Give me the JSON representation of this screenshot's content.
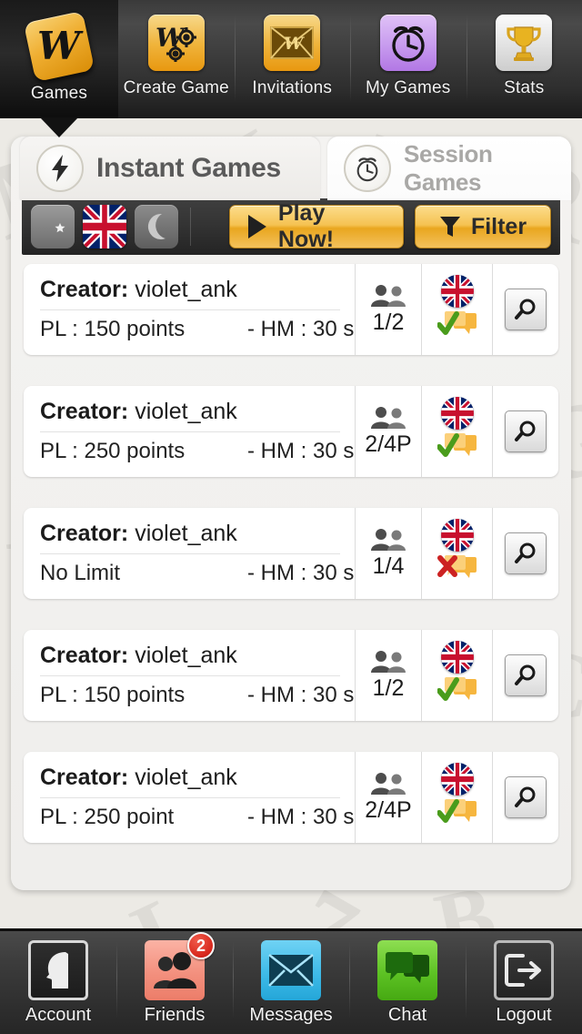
{
  "topnav": {
    "items": [
      {
        "label": "Games",
        "icon": "w-tile-icon",
        "active": true
      },
      {
        "label": "Create Game",
        "icon": "w-gears-icon",
        "active": false
      },
      {
        "label": "Invitations",
        "icon": "envelope-w-icon",
        "active": false
      },
      {
        "label": "My Games",
        "icon": "alarm-clock-icon",
        "active": false
      },
      {
        "label": "Stats",
        "icon": "trophy-icon",
        "active": false
      }
    ]
  },
  "tabs": [
    {
      "label": "Instant Games",
      "icon": "lightning-bolt-icon",
      "active": true
    },
    {
      "label": "Session Games",
      "icon": "alarm-clock-icon",
      "active": false
    }
  ],
  "toolbar": {
    "filters": [
      {
        "name": "turkish-flag-toggle",
        "icon": "crescent-star-icon",
        "active": false
      },
      {
        "name": "uk-flag-toggle",
        "icon": "union-jack-icon",
        "active": true
      },
      {
        "name": "night-mode-toggle",
        "icon": "moon-icon",
        "active": false
      }
    ],
    "play_label": "Play Now!",
    "play_icon": "play-triangle-icon",
    "filter_label": "Filter",
    "filter_icon": "funnel-icon"
  },
  "list": {
    "creator_label": "Creator:",
    "rows": [
      {
        "creator": "violet_ank",
        "limit": "PL :  150 points",
        "time": "- HM :  30 s",
        "players": "1/2",
        "flag": "union-jack-icon",
        "chat": "chat-enabled",
        "action_icon": "magnifier-icon"
      },
      {
        "creator": "violet_ank",
        "limit": "PL :  250 points",
        "time": "- HM :  30 s",
        "players": "2/4P",
        "flag": "union-jack-icon",
        "chat": "chat-enabled",
        "action_icon": "magnifier-icon"
      },
      {
        "creator": "violet_ank",
        "limit": "No Limit",
        "time": "- HM :  30 s",
        "players": "1/4",
        "flag": "union-jack-icon",
        "chat": "chat-disabled",
        "action_icon": "magnifier-icon"
      },
      {
        "creator": "violet_ank",
        "limit": "PL :  150 points",
        "time": "- HM :  30 s",
        "players": "1/2",
        "flag": "union-jack-icon",
        "chat": "chat-enabled",
        "action_icon": "magnifier-icon"
      },
      {
        "creator": "violet_ank",
        "limit": "PL :  250 point",
        "time": "- HM :  30 s",
        "players": "2/4P",
        "flag": "union-jack-icon",
        "chat": "chat-enabled",
        "action_icon": "magnifier-icon"
      }
    ]
  },
  "bottomnav": {
    "items": [
      {
        "label": "Account",
        "icon": "head-silhouette-icon",
        "badge": ""
      },
      {
        "label": "Friends",
        "icon": "two-people-icon",
        "badge": "2"
      },
      {
        "label": "Messages",
        "icon": "envelope-icon",
        "badge": ""
      },
      {
        "label": "Chat",
        "icon": "speech-bubbles-icon",
        "badge": ""
      },
      {
        "label": "Logout",
        "icon": "exit-arrow-icon",
        "badge": ""
      }
    ]
  },
  "colors": {
    "accent_gold": "#eeb03a",
    "panel_bg": "#f2f1ef",
    "toolbar_dark": "#343434",
    "badge_red": "#d7271c",
    "chat_ok_green": "#4a9c1c",
    "chat_no_red": "#cc2222",
    "friends_pink": "#f3907e",
    "messages_blue": "#3fbbe8",
    "chat_green": "#5dc224",
    "mygames_purple": "#c79bee"
  }
}
